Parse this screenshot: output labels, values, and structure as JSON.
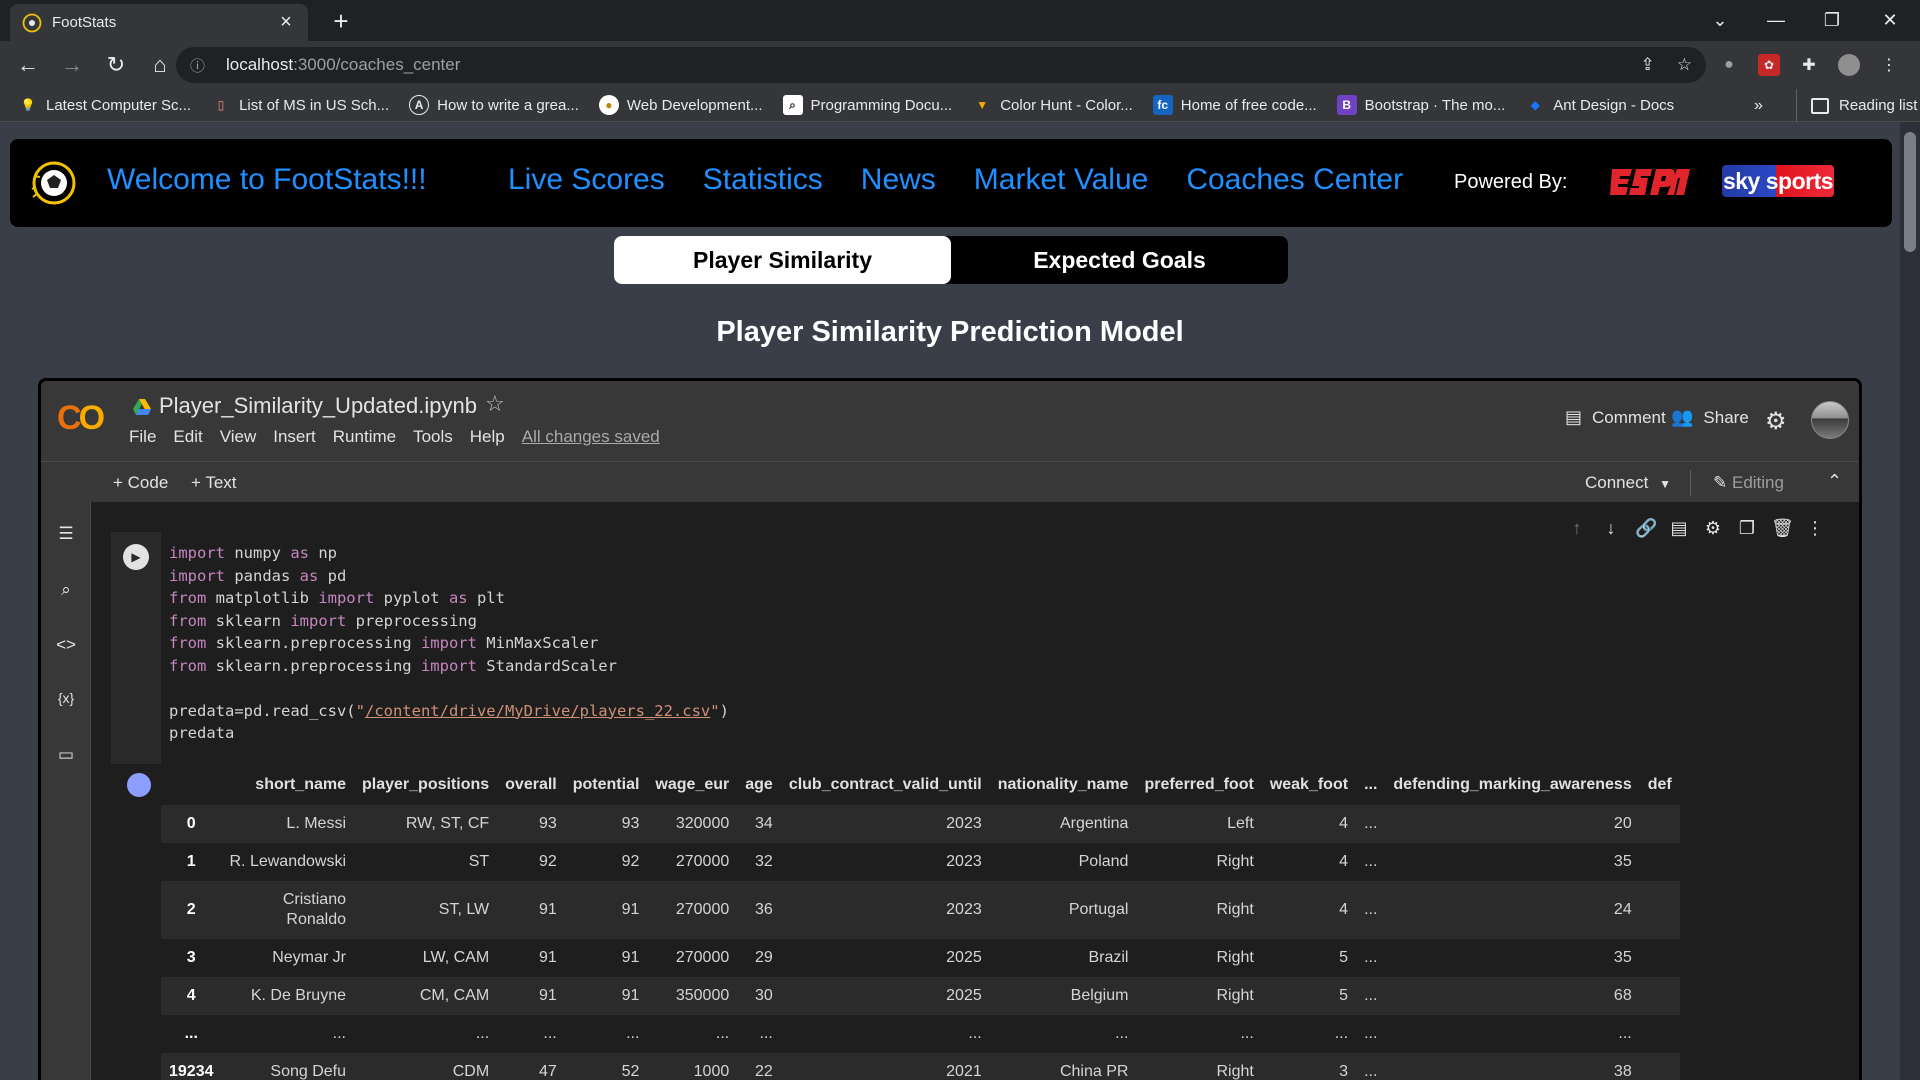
{
  "browser": {
    "tab_title": "FootStats",
    "url_host": "localhost",
    "url_path": ":3000/coaches_center",
    "bookmarks": [
      "Latest Computer Sc...",
      "List of MS in US Sch...",
      "How to write a grea...",
      "Web Development...",
      "Programming Docu...",
      "Color Hunt - Color...",
      "Home of free code...",
      "Bootstrap · The mo...",
      "Ant Design - Docs"
    ],
    "more": "»",
    "reading_list": "Reading list"
  },
  "nav": {
    "welcome": "Welcome to FootStats!!!",
    "links": [
      "Live Scores",
      "Statistics",
      "News",
      "Market Value",
      "Coaches Center"
    ],
    "powered_by": "Powered By:",
    "sky": "sky sports"
  },
  "toggle": {
    "options": [
      "Player Similarity",
      "Expected Goals"
    ],
    "active": "Player Similarity"
  },
  "model_title": "Player Similarity Prediction Model",
  "colab": {
    "filename": "Player_Similarity_Updated.ipynb",
    "menus": [
      "File",
      "Edit",
      "View",
      "Insert",
      "Runtime",
      "Tools",
      "Help"
    ],
    "saved": "All changes saved",
    "comment": "Comment",
    "share": "Share",
    "add_code": "+ Code",
    "add_text": "+ Text",
    "connect": "Connect",
    "editing": "Editing"
  },
  "table": {
    "columns": [
      "",
      "short_name",
      "player_positions",
      "overall",
      "potential",
      "wage_eur",
      "age",
      "club_contract_valid_until",
      "nationality_name",
      "preferred_foot",
      "weak_foot",
      "...",
      "defending_marking_awareness",
      "def"
    ],
    "rows": [
      [
        "0",
        "L. Messi",
        "RW, ST, CF",
        "93",
        "93",
        "320000",
        "34",
        "2023",
        "Argentina",
        "Left",
        "4",
        "...",
        "20"
      ],
      [
        "1",
        "R. Lewandowski",
        "ST",
        "92",
        "92",
        "270000",
        "32",
        "2023",
        "Poland",
        "Right",
        "4",
        "...",
        "35"
      ],
      [
        "2",
        "Cristiano Ronaldo",
        "ST, LW",
        "91",
        "91",
        "270000",
        "36",
        "2023",
        "Portugal",
        "Right",
        "4",
        "...",
        "24"
      ],
      [
        "3",
        "Neymar Jr",
        "LW, CAM",
        "91",
        "91",
        "270000",
        "29",
        "2025",
        "Brazil",
        "Right",
        "5",
        "...",
        "35"
      ],
      [
        "4",
        "K. De Bruyne",
        "CM, CAM",
        "91",
        "91",
        "350000",
        "30",
        "2025",
        "Belgium",
        "Right",
        "5",
        "...",
        "68"
      ],
      [
        "...",
        "...",
        "...",
        "...",
        "...",
        "...",
        "...",
        "...",
        "...",
        "...",
        "...",
        "...",
        "..."
      ],
      [
        "19234",
        "Song Defu",
        "CDM",
        "47",
        "52",
        "1000",
        "22",
        "2021",
        "China PR",
        "Right",
        "3",
        "...",
        "38"
      ]
    ]
  }
}
